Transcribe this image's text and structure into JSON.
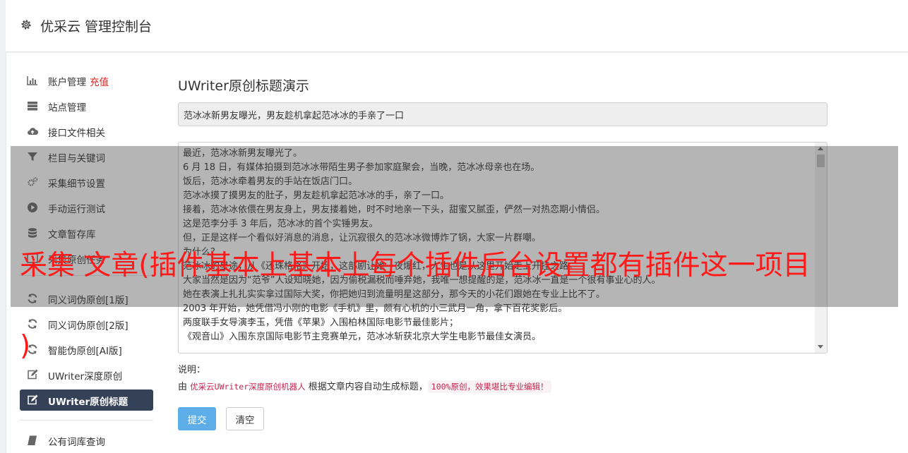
{
  "header": {
    "title": "优采云 管理控制台",
    "icon": "gear-icon"
  },
  "sidebar": {
    "items": [
      {
        "label": "账户管理",
        "badge": "充值",
        "icon": "bar-chart-icon"
      },
      {
        "label": "站点管理",
        "icon": "server-icon"
      },
      {
        "label": "接口文件相关",
        "icon": "cloud-upload-icon"
      },
      {
        "label": "栏目与关键词",
        "icon": "filter-icon"
      },
      {
        "label": "采集细节设置",
        "icon": "cogs-icon"
      },
      {
        "label": "手动运行测试",
        "icon": "play-circle-icon"
      },
      {
        "label": "文章暂存库",
        "icon": "database-icon"
      },
      {
        "label": "采集原创任务",
        "icon": "tasks-icon"
      },
      {
        "label": "同义词伪原创[1版]",
        "icon": "refresh-icon"
      },
      {
        "label": "同义词伪原创[2版]",
        "icon": "refresh-icon"
      },
      {
        "label": "智能伪原创[AI版]",
        "icon": "refresh-icon"
      },
      {
        "label": "UWriter深度原创",
        "icon": "edit-icon"
      },
      {
        "label": "UWriter原创标题",
        "icon": "edit-icon",
        "active": true
      },
      {
        "label": "公有词库查询",
        "icon": "book-icon"
      }
    ]
  },
  "main": {
    "heading": "UWriter原创标题演示",
    "title_value": "范冰冰新男友曝光，男友趁机拿起范冰冰的手亲了一口",
    "content_lines": [
      "最近，范冰冰新男友曝光了。",
      "6 月 18 日，有媒体拍摄到范冰冰带陌生男子参加家庭聚会，当晚，范冰冰母亲也在场。",
      "饭后，范冰冰牵着男友的手站在饭店门口。",
      "范冰冰摸了摸男友的肚子，男友趁机拿起范冰冰的手，亲了一口。",
      "接着，范冰冰依偎在男友身上，男友搂着她，时不时地亲一下头，甜蜜又腻歪，俨然一对热恋期小情侣。",
      "这是范李分手 3 年后，范冰冰的首个实锤男友。",
      "但，正是这样一个看似好消息的消息，让沉寂很久的范冰冰微博炸了锅，大家一片群嘲。",
      "为什么？",
      "范冰冰的星途，从《还珠格格》开始，这部剧让她一夜爆红，人生也是从这里开始走上开挂之路。",
      "大家当然是因为“范爷”人设知晓她，因为偷税漏税而唾弃她，我唯一想提醒的是，范冰冰一直是一个很有事业心的人。",
      "她在表演上扎扎实实拿过国际大奖，你把她归到流量明星这部分，那今天的小花们跟她在专业上比不了。",
      "2003 年开始，她凭借冯小刚的电影《手机》里，颇有心机的小三武月一角，拿下百花奖影后。",
      "两度联手女导演李玉，凭借《苹果》入围柏林国际电影节最佳影片；",
      "《观音山》入围东京国际电影节主竞赛单元，范冰冰斩获北京大学生电影节最佳女演员。"
    ],
    "note_label": "说明：",
    "note_prefix": "由",
    "note_product": "优采云UWriter深度原创机器人",
    "note_mid": "根据文章内容自动生成标题，",
    "note_highlight": "100%原创，效果堪比专业编辑！",
    "submit_label": "提交",
    "clear_label": "清空"
  },
  "overlay": {
    "text": "采集 文章(插件基本上基本上每个插件后台设置都有插件这一项目",
    "tail": ")"
  },
  "colors": {
    "sidebar_active": "#354157",
    "submit_button": "#5daee8",
    "overlay_text": "#ff1a1a",
    "badge": "#e02020"
  }
}
